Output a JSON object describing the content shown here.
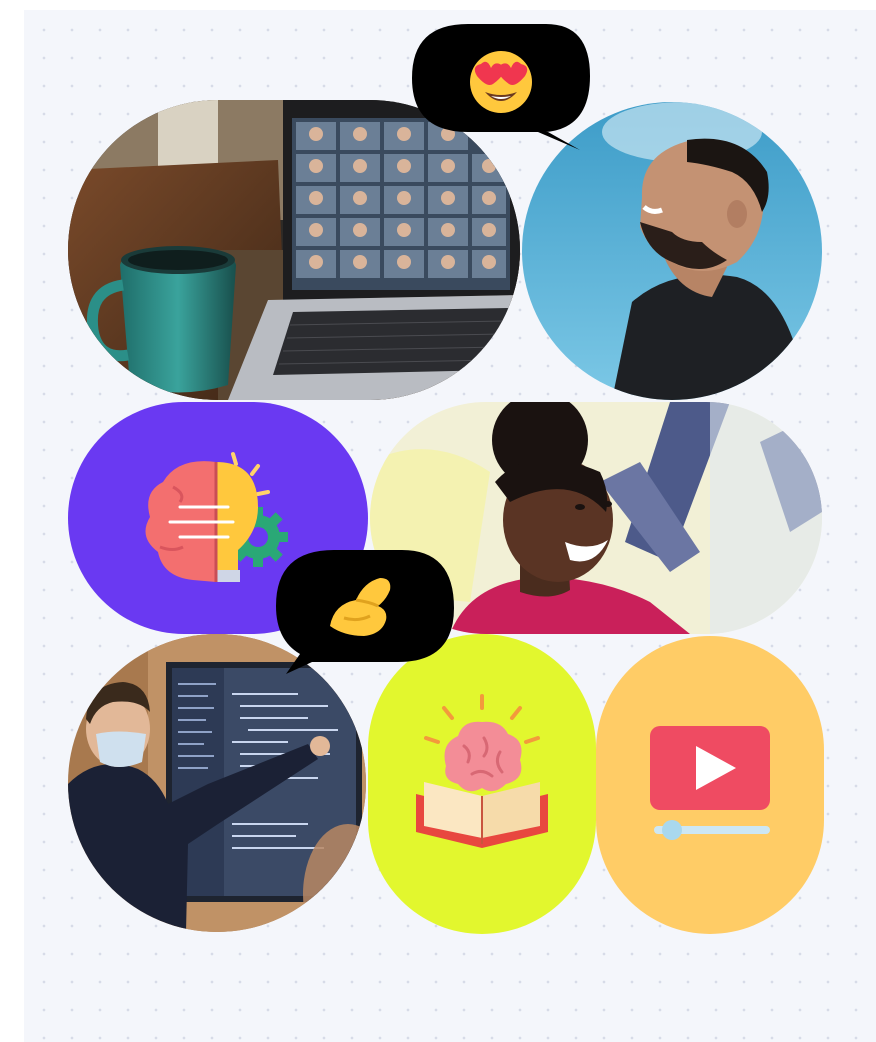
{
  "collage": {
    "background_color": "#f4f6fb",
    "tiles": [
      {
        "name": "video-call-laptop-photo",
        "kind": "photo",
        "shape": "pill"
      },
      {
        "name": "laughing-man-photo",
        "kind": "photo",
        "shape": "circle"
      },
      {
        "name": "brain-lightbulb-illustration",
        "kind": "illustration",
        "shape": "pill",
        "color": "#6a39f2"
      },
      {
        "name": "smiling-woman-photo",
        "kind": "photo",
        "shape": "pill"
      },
      {
        "name": "presenter-code-screen-photo",
        "kind": "photo",
        "shape": "circle"
      },
      {
        "name": "brain-book-illustration",
        "kind": "illustration",
        "shape": "pill",
        "color": "#e2f72e"
      },
      {
        "name": "video-player-illustration",
        "kind": "illustration",
        "shape": "pill",
        "color": "#ffcc66"
      }
    ],
    "bubbles": [
      {
        "name": "heart-eyes-emoji-bubble",
        "emoji": "heart-eyes"
      },
      {
        "name": "pinched-fingers-emoji-bubble",
        "emoji": "pinched-fingers"
      }
    ]
  }
}
